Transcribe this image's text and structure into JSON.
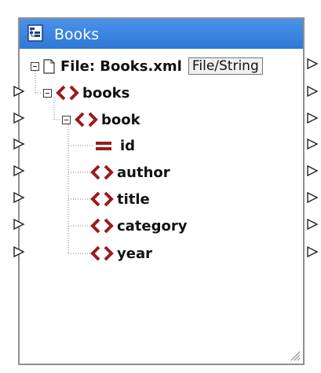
{
  "component": {
    "title": "Books",
    "file_label": "File: Books.xml",
    "file_button_label": "File/String"
  },
  "tree": {
    "root": "books",
    "book": "book",
    "attribute": "id",
    "children": [
      "author",
      "title",
      "category",
      "year"
    ]
  },
  "colors": {
    "title_bar": "#3a84e0",
    "element_icon": "#9b1b1b",
    "tree_lines": "#808080"
  },
  "icons": {
    "title": "component-icon",
    "file": "document-icon",
    "element": "element-icon",
    "attribute": "attribute-icon",
    "connector": "connector-triangle-icon",
    "resize": "resize-grip-icon"
  }
}
